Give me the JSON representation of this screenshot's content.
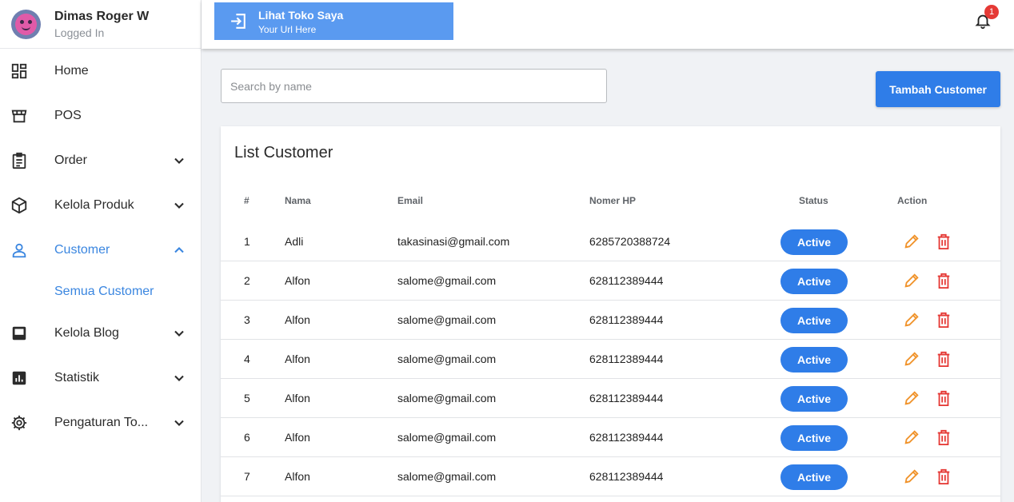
{
  "user": {
    "name": "Dimas Roger W",
    "status": "Logged In"
  },
  "sidebar": {
    "items": [
      {
        "label": "Home",
        "icon": "dashboard-icon"
      },
      {
        "label": "POS",
        "icon": "store-icon"
      },
      {
        "label": "Order",
        "icon": "clipboard-icon"
      },
      {
        "label": "Kelola Produk",
        "icon": "box-icon"
      },
      {
        "label": "Customer",
        "icon": "person-icon"
      },
      {
        "label": "Kelola Blog",
        "icon": "blog-icon"
      },
      {
        "label": "Statistik",
        "icon": "chart-icon"
      },
      {
        "label": "Pengaturan To...",
        "icon": "gear-icon"
      }
    ],
    "customer_sub": "Semua Customer"
  },
  "topbar": {
    "shop_title": "Lihat Toko Saya",
    "shop_sub": "Your Url Here",
    "notif_count": "1"
  },
  "search": {
    "placeholder": "Search by name"
  },
  "add_button": "Tambah Customer",
  "table": {
    "title": "List Customer",
    "headers": [
      "#",
      "Nama",
      "Email",
      "Nomer HP",
      "Status",
      "Action"
    ],
    "rows": [
      {
        "no": "1",
        "name": "Adli",
        "email": "takasinasi@gmail.com",
        "phone": "6285720388724",
        "status": "Active"
      },
      {
        "no": "2",
        "name": "Alfon",
        "email": "salome@gmail.com",
        "phone": "628112389444",
        "status": "Active"
      },
      {
        "no": "3",
        "name": "Alfon",
        "email": "salome@gmail.com",
        "phone": "628112389444",
        "status": "Active"
      },
      {
        "no": "4",
        "name": "Alfon",
        "email": "salome@gmail.com",
        "phone": "628112389444",
        "status": "Active"
      },
      {
        "no": "5",
        "name": "Alfon",
        "email": "salome@gmail.com",
        "phone": "628112389444",
        "status": "Active"
      },
      {
        "no": "6",
        "name": "Alfon",
        "email": "salome@gmail.com",
        "phone": "628112389444",
        "status": "Active"
      },
      {
        "no": "7",
        "name": "Alfon",
        "email": "salome@gmail.com",
        "phone": "628112389444",
        "status": "Active"
      }
    ]
  },
  "colors": {
    "primary": "#2f7de8",
    "active_nav": "#3a86e0",
    "edit": "#f0932b",
    "delete": "#e53935"
  }
}
